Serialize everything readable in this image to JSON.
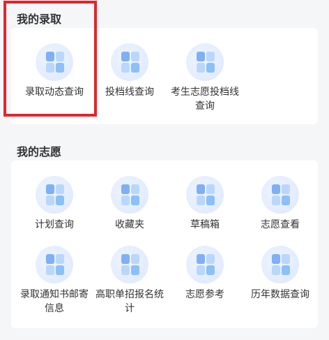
{
  "sections": [
    {
      "title": "我的录取",
      "items": [
        {
          "label": "录取动态查询",
          "icon": "grid-icon"
        },
        {
          "label": "投档线查询",
          "icon": "grid-icon"
        },
        {
          "label": "考生志愿投档线查询",
          "icon": "grid-icon"
        }
      ]
    },
    {
      "title": "我的志愿",
      "items": [
        {
          "label": "计划查询",
          "icon": "grid-icon"
        },
        {
          "label": "收藏夹",
          "icon": "grid-icon"
        },
        {
          "label": "草稿箱",
          "icon": "grid-icon"
        },
        {
          "label": "志愿查看",
          "icon": "grid-icon"
        },
        {
          "label": "录取通知书邮寄信息",
          "icon": "grid-icon"
        },
        {
          "label": "高职单招报名统计",
          "icon": "grid-icon"
        },
        {
          "label": "志愿参考",
          "icon": "grid-icon"
        },
        {
          "label": "历年数据查询",
          "icon": "grid-icon"
        }
      ]
    }
  ],
  "colors": {
    "highlight": "#e5242b",
    "icon_primary": "#7fb0f5",
    "icon_secondary": "#b9d7fb",
    "background": "#f5f6f8"
  }
}
